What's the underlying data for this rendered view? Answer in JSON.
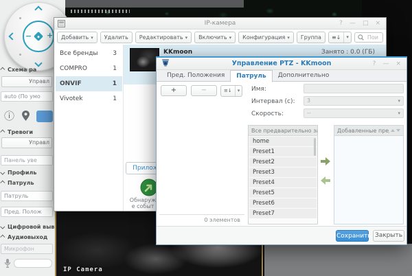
{
  "glyphs": {
    "caret_down": "▾",
    "sort": "≡↓",
    "plus": "+",
    "minus": "−",
    "info": "ⓘ",
    "help": "?",
    "minimize": "—",
    "maximize": "□",
    "close": "×"
  },
  "background": {
    "camera_overlay_label": "IP Camera"
  },
  "sidebar": {
    "scheme_header": "Схема ра",
    "scheme_button": "Управл",
    "layout_value": "auto (По умо",
    "alarm_header": "Тревоги",
    "alarm_button": "Управл",
    "panel_button": "Панель уве",
    "profile_header": "Профиль",
    "patrol_header": "Патруль",
    "patrol_value": "Патруль",
    "preset_value": "Пред. Полож",
    "digital_header": "Цифровой выв",
    "audio_header": "Аудиовыход",
    "mic_value": "Микрофон"
  },
  "ip_window": {
    "title": "IP-камера",
    "toolbar": {
      "add": "Добавить",
      "remove": "Удалить",
      "edit": "Редактировать",
      "enable": "Включить",
      "config": "Конфигурация",
      "group": "Группа",
      "search_placeholder": "Поиск"
    },
    "brands": [
      {
        "name": "Все бренды",
        "count": "3"
      },
      {
        "name": "COMPRO",
        "count": "1"
      },
      {
        "name": "ONVIF",
        "count": "1"
      },
      {
        "name": "Vivotek",
        "count": "1"
      }
    ],
    "camera_row": {
      "name": "KKmoon",
      "usage": "Занято : 0.0 (ГБ)"
    },
    "app_button": "Прилож",
    "event_caption_1": "Обнаруж",
    "event_caption_2": "е событ"
  },
  "ptz_window": {
    "title": "Управление PTZ - KKmoon",
    "tabs": [
      "Пред. Положения",
      "Патруль",
      "Дополнительно"
    ],
    "form": {
      "name_label": "Имя:",
      "interval_label": "Интервал (с):",
      "interval_value": "3",
      "speed_label": "Скорость:",
      "speed_value": "--"
    },
    "lists": {
      "all_header": "Все предварительно задан",
      "added_header": "Добавленные пред",
      "presets": [
        "home",
        "Preset1",
        "Preset2",
        "Preset3",
        "Preset4",
        "Preset5",
        "Preset6",
        "Preset7"
      ],
      "count": "0 элементов"
    },
    "footer": {
      "save": "Сохранить",
      "close": "Закрыть"
    }
  }
}
